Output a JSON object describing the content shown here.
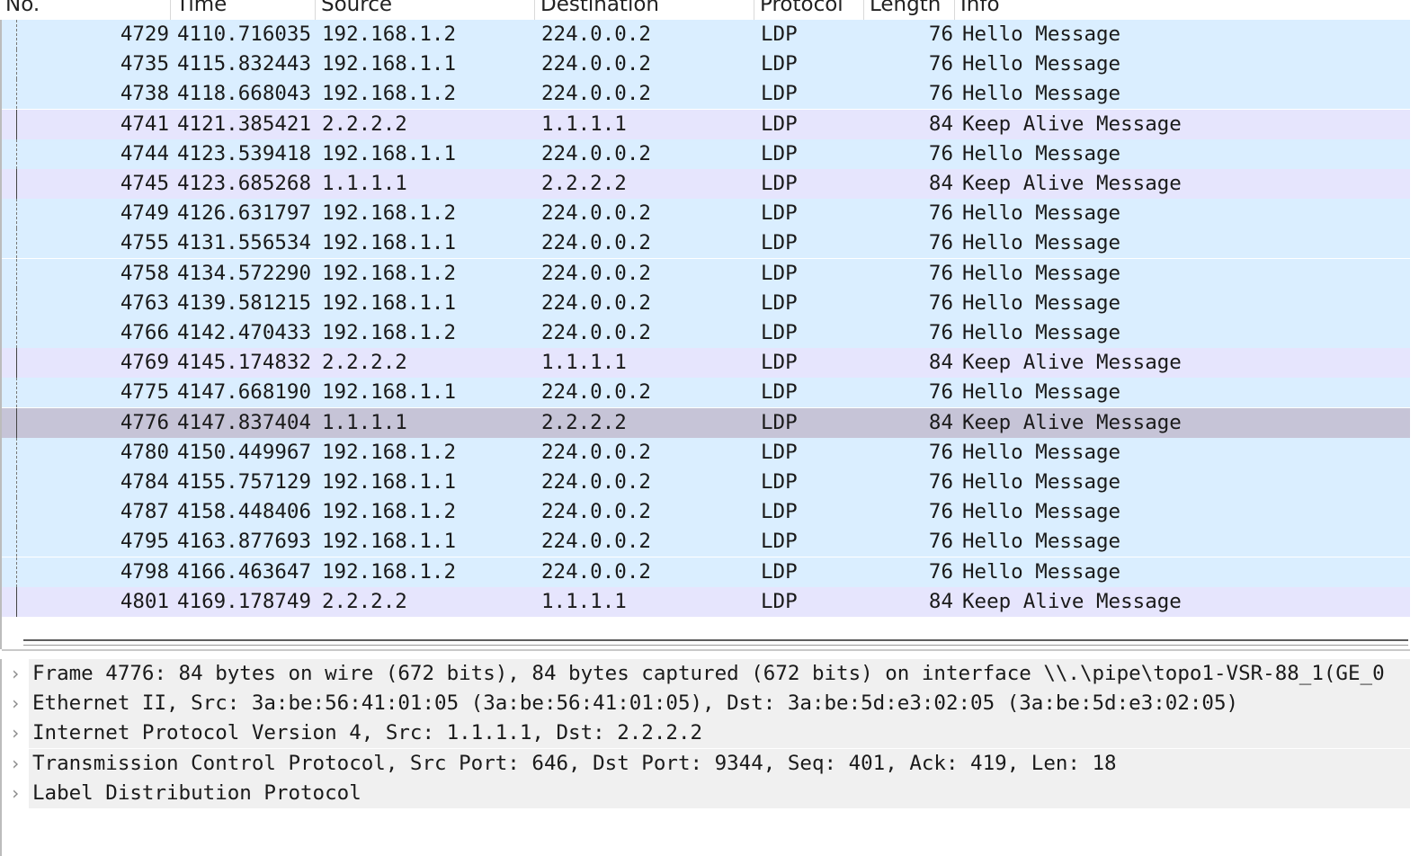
{
  "columns": {
    "no": "No.",
    "time": "Time",
    "source": "Source",
    "destination": "Destination",
    "protocol": "Protocol",
    "length": "Length",
    "info": "Info"
  },
  "packets": [
    {
      "no": "4729",
      "time": "4110.716035",
      "source": "192.168.1.2",
      "destination": "224.0.0.2",
      "protocol": "LDP",
      "length": "76",
      "info": "Hello Message"
    },
    {
      "no": "4735",
      "time": "4115.832443",
      "source": "192.168.1.1",
      "destination": "224.0.0.2",
      "protocol": "LDP",
      "length": "76",
      "info": "Hello Message"
    },
    {
      "no": "4738",
      "time": "4118.668043",
      "source": "192.168.1.2",
      "destination": "224.0.0.2",
      "protocol": "LDP",
      "length": "76",
      "info": "Hello Message"
    },
    {
      "no": "4741",
      "time": "4121.385421",
      "source": "2.2.2.2",
      "destination": "1.1.1.1",
      "protocol": "LDP",
      "length": "84",
      "info": "Keep Alive Message"
    },
    {
      "no": "4744",
      "time": "4123.539418",
      "source": "192.168.1.1",
      "destination": "224.0.0.2",
      "protocol": "LDP",
      "length": "76",
      "info": "Hello Message"
    },
    {
      "no": "4745",
      "time": "4123.685268",
      "source": "1.1.1.1",
      "destination": "2.2.2.2",
      "protocol": "LDP",
      "length": "84",
      "info": "Keep Alive Message"
    },
    {
      "no": "4749",
      "time": "4126.631797",
      "source": "192.168.1.2",
      "destination": "224.0.0.2",
      "protocol": "LDP",
      "length": "76",
      "info": "Hello Message"
    },
    {
      "no": "4755",
      "time": "4131.556534",
      "source": "192.168.1.1",
      "destination": "224.0.0.2",
      "protocol": "LDP",
      "length": "76",
      "info": "Hello Message"
    },
    {
      "no": "4758",
      "time": "4134.572290",
      "source": "192.168.1.2",
      "destination": "224.0.0.2",
      "protocol": "LDP",
      "length": "76",
      "info": "Hello Message"
    },
    {
      "no": "4763",
      "time": "4139.581215",
      "source": "192.168.1.1",
      "destination": "224.0.0.2",
      "protocol": "LDP",
      "length": "76",
      "info": "Hello Message"
    },
    {
      "no": "4766",
      "time": "4142.470433",
      "source": "192.168.1.2",
      "destination": "224.0.0.2",
      "protocol": "LDP",
      "length": "76",
      "info": "Hello Message"
    },
    {
      "no": "4769",
      "time": "4145.174832",
      "source": "2.2.2.2",
      "destination": "1.1.1.1",
      "protocol": "LDP",
      "length": "84",
      "info": "Keep Alive Message"
    },
    {
      "no": "4775",
      "time": "4147.668190",
      "source": "192.168.1.1",
      "destination": "224.0.0.2",
      "protocol": "LDP",
      "length": "76",
      "info": "Hello Message"
    },
    {
      "no": "4776",
      "time": "4147.837404",
      "source": "1.1.1.1",
      "destination": "2.2.2.2",
      "protocol": "LDP",
      "length": "84",
      "info": "Keep Alive Message",
      "selected": true
    },
    {
      "no": "4780",
      "time": "4150.449967",
      "source": "192.168.1.2",
      "destination": "224.0.0.2",
      "protocol": "LDP",
      "length": "76",
      "info": "Hello Message"
    },
    {
      "no": "4784",
      "time": "4155.757129",
      "source": "192.168.1.1",
      "destination": "224.0.0.2",
      "protocol": "LDP",
      "length": "76",
      "info": "Hello Message"
    },
    {
      "no": "4787",
      "time": "4158.448406",
      "source": "192.168.1.2",
      "destination": "224.0.0.2",
      "protocol": "LDP",
      "length": "76",
      "info": "Hello Message"
    },
    {
      "no": "4795",
      "time": "4163.877693",
      "source": "192.168.1.1",
      "destination": "224.0.0.2",
      "protocol": "LDP",
      "length": "76",
      "info": "Hello Message"
    },
    {
      "no": "4798",
      "time": "4166.463647",
      "source": "192.168.1.2",
      "destination": "224.0.0.2",
      "protocol": "LDP",
      "length": "76",
      "info": "Hello Message"
    },
    {
      "no": "4801",
      "time": "4169.178749",
      "source": "2.2.2.2",
      "destination": "1.1.1.1",
      "protocol": "LDP",
      "length": "84",
      "info": "Keep Alive Message"
    }
  ],
  "details": [
    {
      "text": "Frame 4776: 84 bytes on wire (672 bits), 84 bytes captured (672 bits) on interface \\\\.\\pipe\\topo1-VSR-88_1(GE_0"
    },
    {
      "text": "Ethernet II, Src: 3a:be:56:41:01:05 (3a:be:56:41:01:05), Dst: 3a:be:5d:e3:02:05 (3a:be:5d:e3:02:05)"
    },
    {
      "text": "Internet Protocol Version 4, Src: 1.1.1.1, Dst: 2.2.2.2"
    },
    {
      "text": "Transmission Control Protocol, Src Port: 646, Dst Port: 9344, Seq: 401, Ack: 419, Len: 18"
    },
    {
      "text": "Label Distribution Protocol"
    }
  ],
  "icons": {
    "expand": "chevron-right-icon"
  },
  "colors": {
    "hello_row": "#daeeff",
    "keepalive_row": "#e6e5fd",
    "selected_row": "#c6c4d7",
    "detail_row": "#f0f0f0"
  }
}
